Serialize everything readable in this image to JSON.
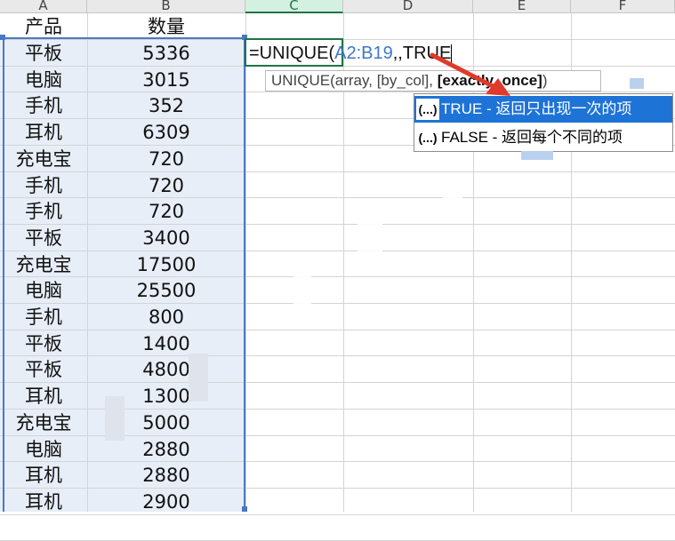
{
  "columns": [
    "A",
    "B",
    "C",
    "D",
    "E",
    "F"
  ],
  "active_column": "C",
  "header_row": {
    "a": "产品",
    "b": "数量"
  },
  "rows": [
    {
      "product": "平板",
      "qty": "5336"
    },
    {
      "product": "电脑",
      "qty": "3015"
    },
    {
      "product": "手机",
      "qty": "352"
    },
    {
      "product": "耳机",
      "qty": "6309"
    },
    {
      "product": "充电宝",
      "qty": "720"
    },
    {
      "product": "手机",
      "qty": "720"
    },
    {
      "product": "手机",
      "qty": "720"
    },
    {
      "product": "平板",
      "qty": "3400"
    },
    {
      "product": "充电宝",
      "qty": "17500"
    },
    {
      "product": "电脑",
      "qty": "25500"
    },
    {
      "product": "手机",
      "qty": "800"
    },
    {
      "product": "平板",
      "qty": "1400"
    },
    {
      "product": "平板",
      "qty": "4800"
    },
    {
      "product": "耳机",
      "qty": "1300"
    },
    {
      "product": "充电宝",
      "qty": "5000"
    },
    {
      "product": "电脑",
      "qty": "2880"
    },
    {
      "product": "耳机",
      "qty": "2880"
    },
    {
      "product": "耳机",
      "qty": "2900"
    }
  ],
  "formula": {
    "prefix": "=UNIQUE(",
    "range": "A2:B19",
    "suffix": ",,TRUE"
  },
  "tooltip": {
    "fn": "UNIQUE(array, [by_col], ",
    "bold_arg": "[exactly_once]",
    "close": ")"
  },
  "autocomplete": [
    {
      "icon": "(...)",
      "label": "TRUE - 返回只出现一次的项",
      "selected": true
    },
    {
      "icon": "(...)",
      "label": "FALSE - 返回每个不同的项",
      "selected": false
    }
  ],
  "colors": {
    "selection_border": "#4a78c2",
    "active_cell_border": "#217346",
    "dropdown_highlight": "#1e73d6",
    "arrow": "#e03a2a"
  }
}
